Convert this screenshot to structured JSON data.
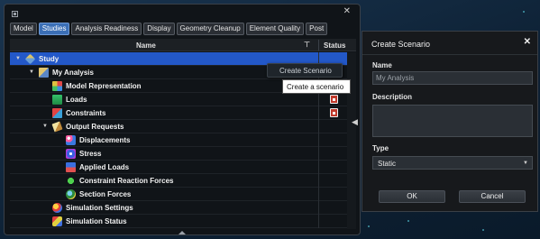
{
  "tabs": [
    {
      "label": "Model",
      "active": false
    },
    {
      "label": "Studies",
      "active": true
    },
    {
      "label": "Analysis Readiness",
      "active": false
    },
    {
      "label": "Display",
      "active": false
    },
    {
      "label": "Geometry Cleanup",
      "active": false
    },
    {
      "label": "Element Quality",
      "active": false
    },
    {
      "label": "Post",
      "active": false
    }
  ],
  "tree_header": {
    "name": "Name",
    "filter_icon": "filter-icon",
    "status": "Status"
  },
  "tree": [
    {
      "label": "Study",
      "level": 0,
      "expanded": true,
      "icon": "study-icon",
      "selected": true
    },
    {
      "label": "My Analysis",
      "level": 1,
      "expanded": true,
      "icon": "analysis-icon"
    },
    {
      "label": "Model Representation",
      "level": 2,
      "icon": "model-representation-icon"
    },
    {
      "label": "Loads",
      "level": 2,
      "icon": "loads-icon",
      "status_icon": "error-badge-icon"
    },
    {
      "label": "Constraints",
      "level": 2,
      "icon": "constraints-icon",
      "status_icon": "error-badge-icon"
    },
    {
      "label": "Output Requests",
      "level": 2,
      "expanded": true,
      "icon": "output-requests-icon"
    },
    {
      "label": "Displacements",
      "level": 3,
      "icon": "displacements-icon"
    },
    {
      "label": "Stress",
      "level": 3,
      "icon": "stress-icon"
    },
    {
      "label": "Applied Loads",
      "level": 3,
      "icon": "applied-loads-icon"
    },
    {
      "label": "Constraint Reaction Forces",
      "level": 3,
      "icon": "constraint-reaction-forces-icon"
    },
    {
      "label": "Section Forces",
      "level": 3,
      "icon": "section-forces-icon"
    },
    {
      "label": "Simulation Settings",
      "level": 2,
      "icon": "simulation-settings-icon"
    },
    {
      "label": "Simulation Status",
      "level": 2,
      "icon": "simulation-status-icon"
    }
  ],
  "context_menu": {
    "item": "Create Scenario"
  },
  "tooltip": {
    "text": "Create a scenario"
  },
  "dialog": {
    "title": "Create Scenario",
    "name_label": "Name",
    "name_value": "My Analysis",
    "description_label": "Description",
    "description_value": "",
    "type_label": "Type",
    "type_value": "Static",
    "ok_label": "OK",
    "cancel_label": "Cancel"
  },
  "colors": {
    "selection": "#2358c8",
    "active_tab": "#3b6fb6",
    "status_error": "#c0392b"
  }
}
